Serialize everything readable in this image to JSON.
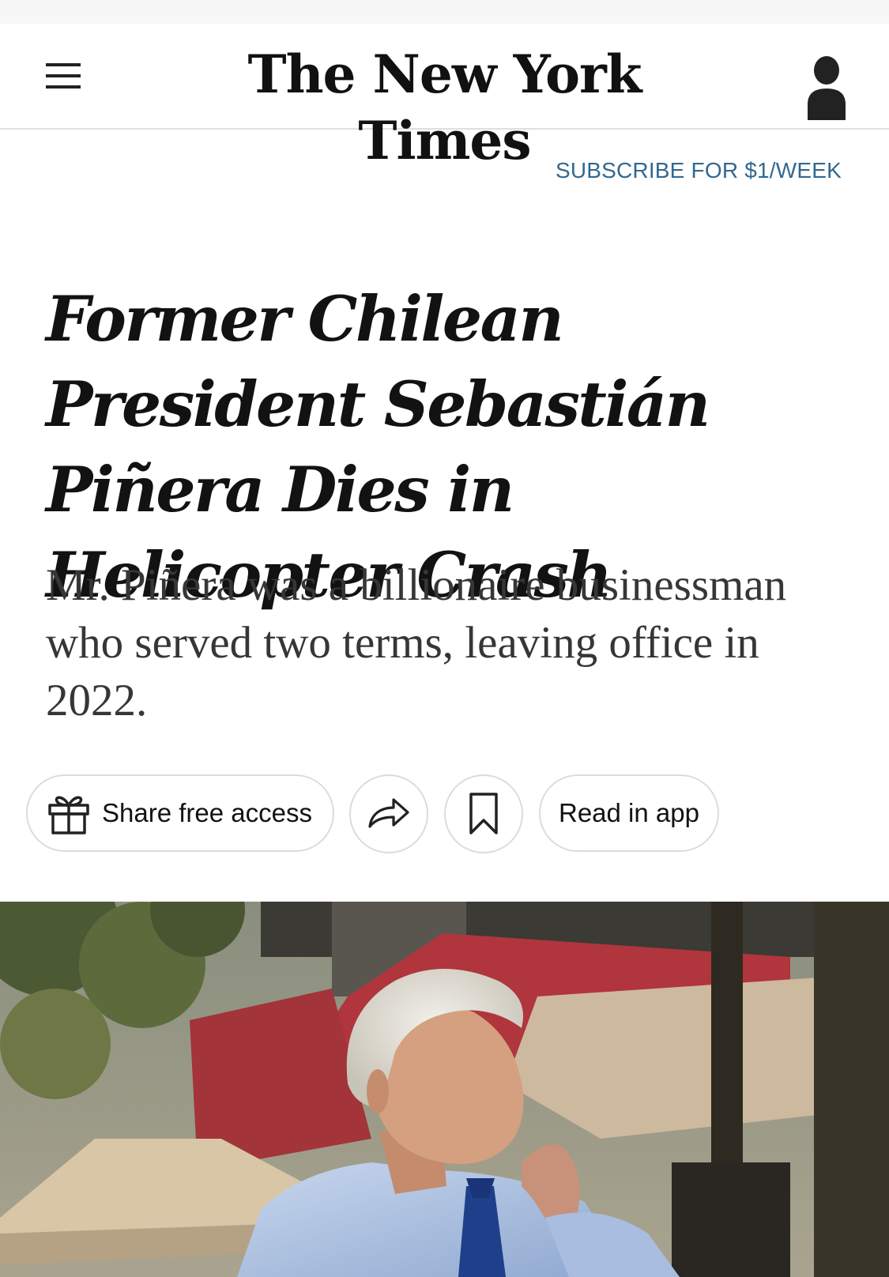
{
  "masthead": {
    "logo_text": "The New York Times",
    "menu_icon": "hamburger-menu-icon",
    "account_icon": "account-icon"
  },
  "subscribe_link": "SUBSCRIBE FOR $1/WEEK",
  "article": {
    "headline": "Former Chilean President Sebastián Piñera Dies in Helicopter Crash",
    "summary": "Mr. Piñera was a billionaire businessman who served two terms, leaving office in 2022."
  },
  "actions": {
    "share_free_access": "Share free access",
    "share_icon": "gift-icon",
    "forward_icon": "share-arrow-icon",
    "save_icon": "bookmark-icon",
    "read_in_app": "Read in app"
  },
  "colors": {
    "subscribe": "#326891",
    "text": "#121212",
    "summary": "#363636",
    "pill_border": "#dcdcdc"
  }
}
